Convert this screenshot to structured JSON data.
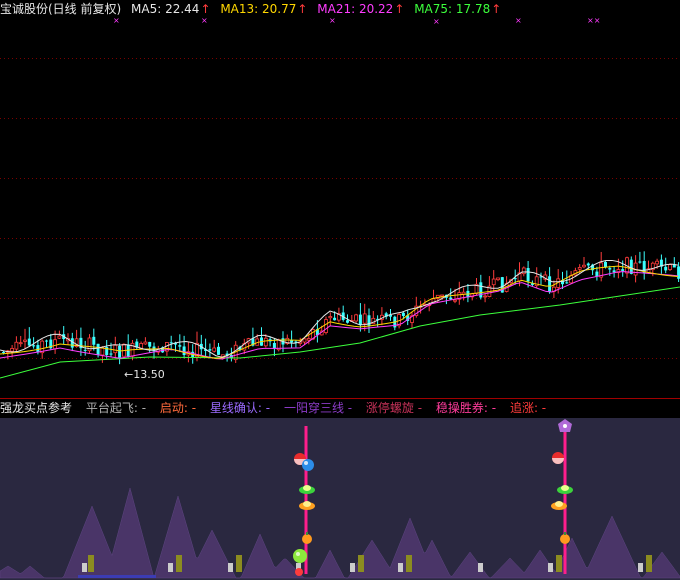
{
  "stock": {
    "title": "宝诚股份(日线 前复权)"
  },
  "ma_legend": [
    {
      "label": "MA5: 22.44",
      "color": "#e6e6e6"
    },
    {
      "label": "MA13: 20.77",
      "color": "#ffd700"
    },
    {
      "label": "MA21: 20.22",
      "color": "#ff3cff"
    },
    {
      "label": "MA75: 17.78",
      "color": "#3cff3c"
    }
  ],
  "ma_arrow": "↑",
  "price_annotation": "←13.50",
  "indicator": {
    "title": "强龙买点参考",
    "signals": [
      {
        "label": "平台起飞: -",
        "color": "#b0b0b0"
      },
      {
        "label": "启动: -",
        "color": "#ff6a3c"
      },
      {
        "label": "星线确认: -",
        "color": "#9b6bff"
      },
      {
        "label": "一阳穿三线 -",
        "color": "#8c3cc8"
      },
      {
        "label": "涨停螺旋 -",
        "color": "#c8325a"
      },
      {
        "label": "稳操胜券: -",
        "color": "#ff3c9b"
      },
      {
        "label": "追涨: -",
        "color": "#ff3c3c"
      }
    ]
  },
  "colors": {
    "up": "#ff3c3c",
    "down": "#3cffff",
    "ma5": "#e6e6e6",
    "ma13": "#ffd700",
    "ma21": "#ff3cff",
    "ma75": "#3cff3c",
    "grid": "#7a0000",
    "indicator_bg": "#2a2840",
    "mountain": "#4a3568",
    "signal_line": "#ff1e8c"
  },
  "icons": [
    "x-marker-icon",
    "star-marker-icon",
    "red-ball-icon",
    "blue-ball-icon",
    "green-ingot-icon",
    "gold-ingot-icon",
    "orange-fruit-icon",
    "green-apple-icon",
    "purple-crown-icon"
  ]
}
